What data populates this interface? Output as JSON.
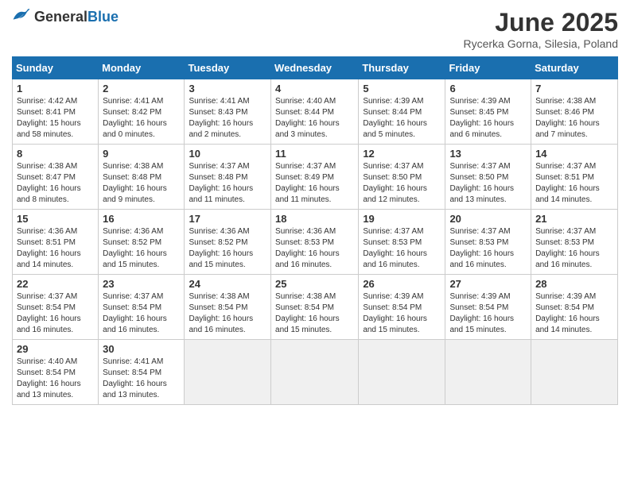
{
  "header": {
    "logo_general": "General",
    "logo_blue": "Blue",
    "month": "June 2025",
    "location": "Rycerka Gorna, Silesia, Poland"
  },
  "weekdays": [
    "Sunday",
    "Monday",
    "Tuesday",
    "Wednesday",
    "Thursday",
    "Friday",
    "Saturday"
  ],
  "weeks": [
    [
      {
        "day": "1",
        "info": "Sunrise: 4:42 AM\nSunset: 8:41 PM\nDaylight: 15 hours\nand 58 minutes."
      },
      {
        "day": "2",
        "info": "Sunrise: 4:41 AM\nSunset: 8:42 PM\nDaylight: 16 hours\nand 0 minutes."
      },
      {
        "day": "3",
        "info": "Sunrise: 4:41 AM\nSunset: 8:43 PM\nDaylight: 16 hours\nand 2 minutes."
      },
      {
        "day": "4",
        "info": "Sunrise: 4:40 AM\nSunset: 8:44 PM\nDaylight: 16 hours\nand 3 minutes."
      },
      {
        "day": "5",
        "info": "Sunrise: 4:39 AM\nSunset: 8:44 PM\nDaylight: 16 hours\nand 5 minutes."
      },
      {
        "day": "6",
        "info": "Sunrise: 4:39 AM\nSunset: 8:45 PM\nDaylight: 16 hours\nand 6 minutes."
      },
      {
        "day": "7",
        "info": "Sunrise: 4:38 AM\nSunset: 8:46 PM\nDaylight: 16 hours\nand 7 minutes."
      }
    ],
    [
      {
        "day": "8",
        "info": "Sunrise: 4:38 AM\nSunset: 8:47 PM\nDaylight: 16 hours\nand 8 minutes."
      },
      {
        "day": "9",
        "info": "Sunrise: 4:38 AM\nSunset: 8:48 PM\nDaylight: 16 hours\nand 9 minutes."
      },
      {
        "day": "10",
        "info": "Sunrise: 4:37 AM\nSunset: 8:48 PM\nDaylight: 16 hours\nand 11 minutes."
      },
      {
        "day": "11",
        "info": "Sunrise: 4:37 AM\nSunset: 8:49 PM\nDaylight: 16 hours\nand 11 minutes."
      },
      {
        "day": "12",
        "info": "Sunrise: 4:37 AM\nSunset: 8:50 PM\nDaylight: 16 hours\nand 12 minutes."
      },
      {
        "day": "13",
        "info": "Sunrise: 4:37 AM\nSunset: 8:50 PM\nDaylight: 16 hours\nand 13 minutes."
      },
      {
        "day": "14",
        "info": "Sunrise: 4:37 AM\nSunset: 8:51 PM\nDaylight: 16 hours\nand 14 minutes."
      }
    ],
    [
      {
        "day": "15",
        "info": "Sunrise: 4:36 AM\nSunset: 8:51 PM\nDaylight: 16 hours\nand 14 minutes."
      },
      {
        "day": "16",
        "info": "Sunrise: 4:36 AM\nSunset: 8:52 PM\nDaylight: 16 hours\nand 15 minutes."
      },
      {
        "day": "17",
        "info": "Sunrise: 4:36 AM\nSunset: 8:52 PM\nDaylight: 16 hours\nand 15 minutes."
      },
      {
        "day": "18",
        "info": "Sunrise: 4:36 AM\nSunset: 8:53 PM\nDaylight: 16 hours\nand 16 minutes."
      },
      {
        "day": "19",
        "info": "Sunrise: 4:37 AM\nSunset: 8:53 PM\nDaylight: 16 hours\nand 16 minutes."
      },
      {
        "day": "20",
        "info": "Sunrise: 4:37 AM\nSunset: 8:53 PM\nDaylight: 16 hours\nand 16 minutes."
      },
      {
        "day": "21",
        "info": "Sunrise: 4:37 AM\nSunset: 8:53 PM\nDaylight: 16 hours\nand 16 minutes."
      }
    ],
    [
      {
        "day": "22",
        "info": "Sunrise: 4:37 AM\nSunset: 8:54 PM\nDaylight: 16 hours\nand 16 minutes."
      },
      {
        "day": "23",
        "info": "Sunrise: 4:37 AM\nSunset: 8:54 PM\nDaylight: 16 hours\nand 16 minutes."
      },
      {
        "day": "24",
        "info": "Sunrise: 4:38 AM\nSunset: 8:54 PM\nDaylight: 16 hours\nand 16 minutes."
      },
      {
        "day": "25",
        "info": "Sunrise: 4:38 AM\nSunset: 8:54 PM\nDaylight: 16 hours\nand 15 minutes."
      },
      {
        "day": "26",
        "info": "Sunrise: 4:39 AM\nSunset: 8:54 PM\nDaylight: 16 hours\nand 15 minutes."
      },
      {
        "day": "27",
        "info": "Sunrise: 4:39 AM\nSunset: 8:54 PM\nDaylight: 16 hours\nand 15 minutes."
      },
      {
        "day": "28",
        "info": "Sunrise: 4:39 AM\nSunset: 8:54 PM\nDaylight: 16 hours\nand 14 minutes."
      }
    ],
    [
      {
        "day": "29",
        "info": "Sunrise: 4:40 AM\nSunset: 8:54 PM\nDaylight: 16 hours\nand 13 minutes."
      },
      {
        "day": "30",
        "info": "Sunrise: 4:41 AM\nSunset: 8:54 PM\nDaylight: 16 hours\nand 13 minutes."
      },
      {
        "day": "",
        "info": ""
      },
      {
        "day": "",
        "info": ""
      },
      {
        "day": "",
        "info": ""
      },
      {
        "day": "",
        "info": ""
      },
      {
        "day": "",
        "info": ""
      }
    ]
  ]
}
